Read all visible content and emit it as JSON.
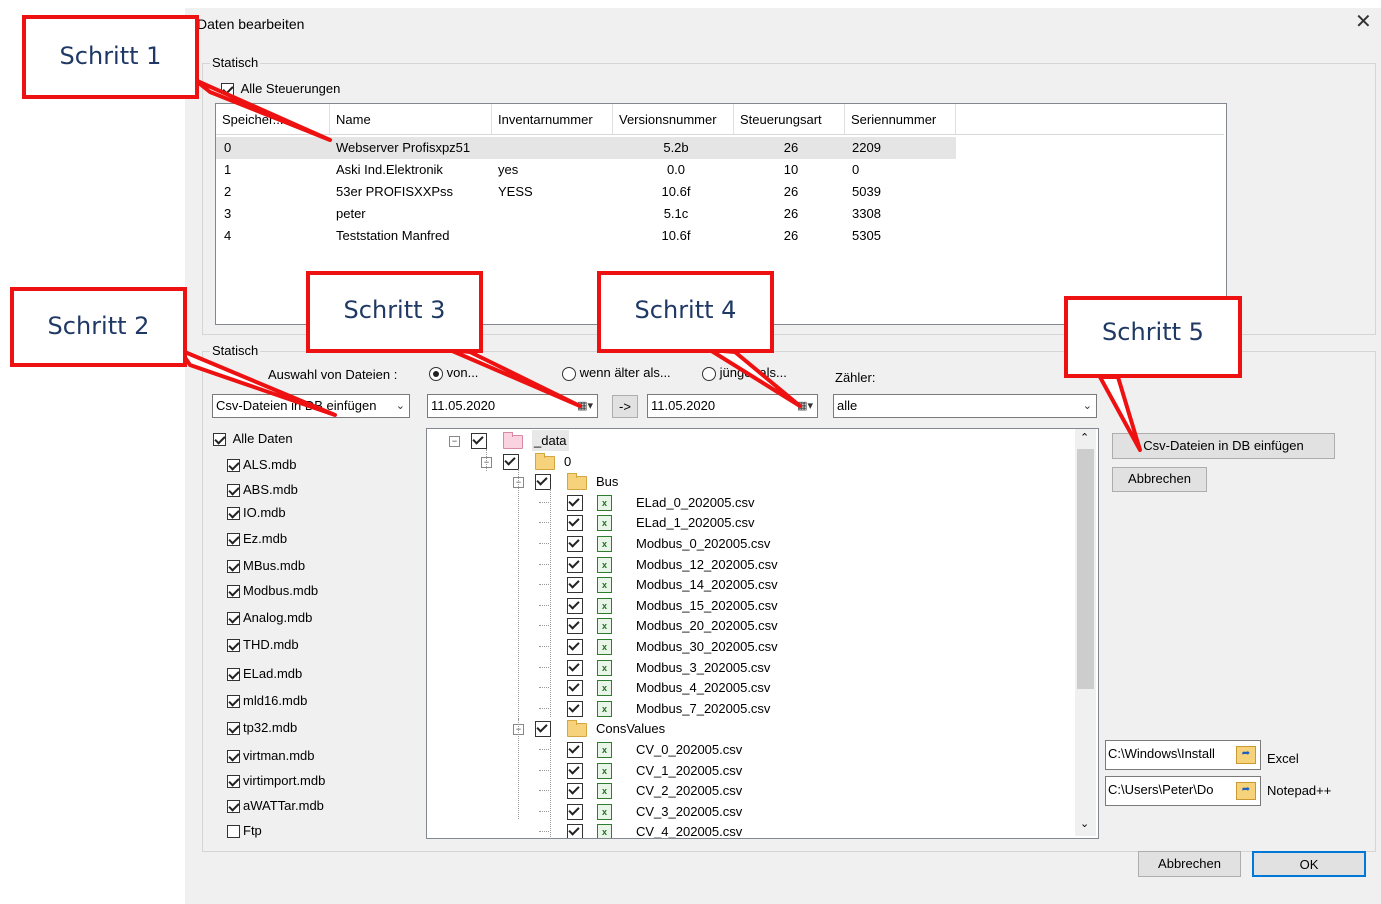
{
  "dialog": {
    "title": "Daten bearbeiten",
    "close_label": "✕",
    "group1_label": "Statisch",
    "all_controllers_label": "Alle Steuerungen",
    "group2_label": "Statisch"
  },
  "controllers_table": {
    "columns": [
      "Speicher...",
      "Name",
      "Inventarnummer",
      "Versionsnummer",
      "Steuerungsart",
      "Seriennummer"
    ],
    "rows": [
      {
        "speicher": "0",
        "name": "Webserver Profisxpz51",
        "inventar": "",
        "version": "5.2b",
        "art": "26",
        "serie": "2209"
      },
      {
        "speicher": "1",
        "name": "Aski Ind.Elektronik",
        "inventar": "yes",
        "version": "0.0",
        "art": "10",
        "serie": "0"
      },
      {
        "speicher": "2",
        "name": "53er PROFISXXPss",
        "inventar": "YESS",
        "version": "10.6f",
        "art": "26",
        "serie": "5039"
      },
      {
        "speicher": "3",
        "name": "peter",
        "inventar": "",
        "version": "5.1c",
        "art": "26",
        "serie": "3308"
      },
      {
        "speicher": "4",
        "name": "Teststation Manfred",
        "inventar": "",
        "version": "10.6f",
        "art": "26",
        "serie": "5305"
      }
    ]
  },
  "filter": {
    "selection_label": "Auswahl von Dateien :",
    "radio_from": "von...",
    "radio_older": "wenn älter als...",
    "radio_younger": "jünger als...",
    "counter_label": "Zähler:",
    "action_select": "Csv-Dateien in DB einfügen",
    "date_from": "11.05.2020",
    "arrow_button": "->",
    "date_to": "11.05.2020",
    "counter_select": "alle"
  },
  "databases": {
    "all_label": "Alle Daten",
    "items": [
      {
        "label": "ALS.mdb",
        "checked": true
      },
      {
        "label": "ABS.mdb",
        "checked": true
      },
      {
        "label": "IO.mdb",
        "checked": true
      },
      {
        "label": "Ez.mdb",
        "checked": true
      },
      {
        "label": "MBus.mdb",
        "checked": true
      },
      {
        "label": "Modbus.mdb",
        "checked": true
      },
      {
        "label": "Analog.mdb",
        "checked": true
      },
      {
        "label": "THD.mdb",
        "checked": true
      },
      {
        "label": "ELad.mdb",
        "checked": true
      },
      {
        "label": "mld16.mdb",
        "checked": true
      },
      {
        "label": "tp32.mdb",
        "checked": true
      },
      {
        "label": "virtman.mdb",
        "checked": true
      },
      {
        "label": "virtimport.mdb",
        "checked": true
      },
      {
        "label": "aWATTar.mdb",
        "checked": true
      },
      {
        "label": "Ftp",
        "checked": false
      }
    ]
  },
  "tree": {
    "nodes": [
      {
        "label": "_data",
        "level": 0,
        "kind": "root"
      },
      {
        "label": "0",
        "level": 1,
        "kind": "folder"
      },
      {
        "label": "Bus",
        "level": 2,
        "kind": "folder"
      },
      {
        "label": "ELad_0_202005.csv",
        "level": 3,
        "kind": "file"
      },
      {
        "label": "ELad_1_202005.csv",
        "level": 3,
        "kind": "file"
      },
      {
        "label": "Modbus_0_202005.csv",
        "level": 3,
        "kind": "file"
      },
      {
        "label": "Modbus_12_202005.csv",
        "level": 3,
        "kind": "file"
      },
      {
        "label": "Modbus_14_202005.csv",
        "level": 3,
        "kind": "file"
      },
      {
        "label": "Modbus_15_202005.csv",
        "level": 3,
        "kind": "file"
      },
      {
        "label": "Modbus_20_202005.csv",
        "level": 3,
        "kind": "file"
      },
      {
        "label": "Modbus_30_202005.csv",
        "level": 3,
        "kind": "file"
      },
      {
        "label": "Modbus_3_202005.csv",
        "level": 3,
        "kind": "file"
      },
      {
        "label": "Modbus_4_202005.csv",
        "level": 3,
        "kind": "file"
      },
      {
        "label": "Modbus_7_202005.csv",
        "level": 3,
        "kind": "file"
      },
      {
        "label": "ConsValues",
        "level": 2,
        "kind": "folder"
      },
      {
        "label": "CV_0_202005.csv",
        "level": 3,
        "kind": "file"
      },
      {
        "label": "CV_1_202005.csv",
        "level": 3,
        "kind": "file"
      },
      {
        "label": "CV_2_202005.csv",
        "level": 3,
        "kind": "file"
      },
      {
        "label": "CV_3_202005.csv",
        "level": 3,
        "kind": "file"
      },
      {
        "label": "CV_4_202005.csv",
        "level": 3,
        "kind": "file"
      }
    ]
  },
  "actions": {
    "insert_button": "Csv-Dateien in DB einfügen",
    "cancel_button": "Abbrechen",
    "excel_path": "C:\\Windows\\Install",
    "excel_label": "Excel",
    "notepad_path": "C:\\Users\\Peter\\Do",
    "notepad_label": "Notepad++",
    "footer_cancel": "Abbrechen",
    "footer_ok": "OK"
  },
  "callouts": {
    "step1": "Schritt 1",
    "step2": "Schritt 2",
    "step3": "Schritt 3",
    "step4": "Schritt 4",
    "step5": "Schritt 5"
  },
  "colors": {
    "callout_border": "#ee1111",
    "callout_text": "#1f3864",
    "dialog_bg": "#f0f0f0"
  }
}
